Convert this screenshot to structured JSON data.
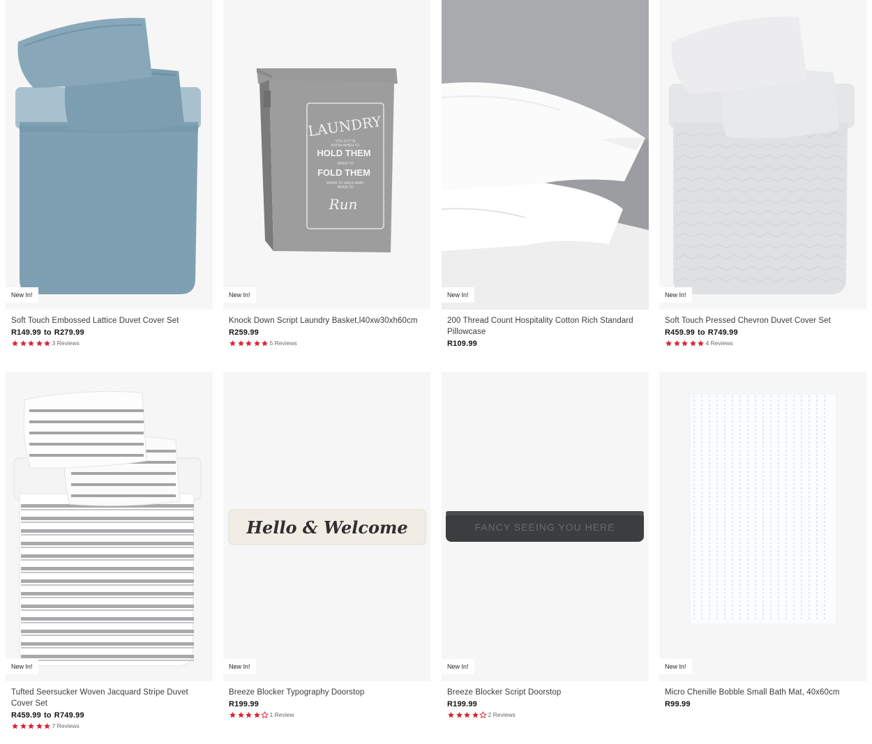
{
  "colors": {
    "star": "#d92635",
    "badge_bg": "#ffffff",
    "image_bg": "#f6f6f6"
  },
  "products": [
    {
      "badge": "New In!",
      "title": "Soft Touch Embossed Lattice Duvet Cover Set",
      "price_from": "R149.99",
      "price_sep": "to",
      "price_to": "R279.99",
      "rating": 5,
      "reviews": "3 Reviews",
      "image": "duvet-blue"
    },
    {
      "badge": "New In!",
      "title": "Knock Down Script Laundry Basket,l40xw30xh60cm",
      "price_from": "R259.99",
      "price_sep": "",
      "price_to": "",
      "rating": 5,
      "reviews": "5 Reviews",
      "image": "laundry-basket",
      "image_text": {
        "laundry": "LAUNDRY",
        "small1": "YOU GOTTA",
        "small2": "KNOW WHEN TO",
        "hold": "HOLD THEM",
        "small3": "WHEN TO",
        "fold": "FOLD THEM",
        "small4": "WHEN TO WALK AWAY",
        "small5": "WHEN TO",
        "run": "Run"
      }
    },
    {
      "badge": "New In!",
      "title": "200 Thread Count Hospitality Cotton Rich Standard Pillowcase",
      "price_from": "R109.99",
      "price_sep": "",
      "price_to": "",
      "rating": null,
      "reviews": "",
      "image": "pillowcase"
    },
    {
      "badge": "New In!",
      "title": "Soft Touch Pressed Chevron Duvet Cover Set",
      "price_from": "R459.99",
      "price_sep": "to",
      "price_to": "R749.99",
      "rating": 5,
      "reviews": "4 Reviews",
      "image": "duvet-white"
    },
    {
      "badge": "New In!",
      "title": "Tufted Seersucker Woven Jacquard Stripe Duvet Cover Set",
      "price_from": "R459.99",
      "price_sep": "to",
      "price_to": "R749.99",
      "rating": 5,
      "reviews": "7 Reviews",
      "image": "duvet-stripe"
    },
    {
      "badge": "New In!",
      "title": "Breeze Blocker Typography Doorstop",
      "price_from": "R199.99",
      "price_sep": "",
      "price_to": "",
      "rating": 4,
      "reviews": "1 Review",
      "image": "doorstop-cream",
      "image_text": {
        "print": "Hello & Welcome"
      }
    },
    {
      "badge": "New In!",
      "title": "Breeze Blocker Script Doorstop",
      "price_from": "R199.99",
      "price_sep": "",
      "price_to": "",
      "rating": 4,
      "reviews": "2 Reviews",
      "image": "doorstop-dark",
      "image_text": {
        "print": "FANCY SEEING YOU HERE"
      }
    },
    {
      "badge": "New In!",
      "title": "Micro Chenille Bobble Small Bath Mat, 40x60cm",
      "price_from": "R99.99",
      "price_sep": "",
      "price_to": "",
      "rating": null,
      "reviews": "",
      "image": "bath-mat"
    }
  ]
}
